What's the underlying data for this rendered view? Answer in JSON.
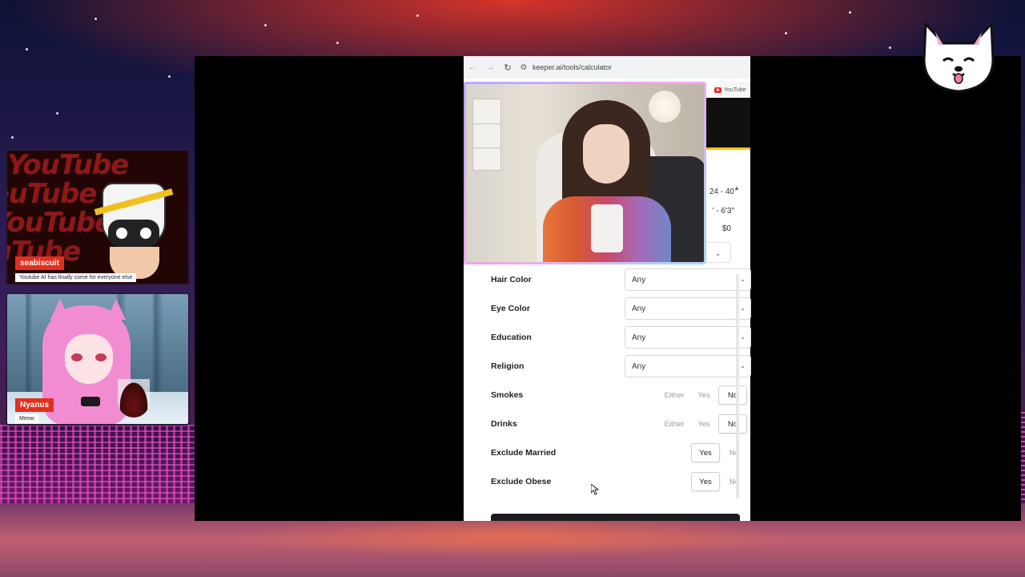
{
  "browser": {
    "url": "keeper.ai/tools/calculator",
    "youtube_tab": "YouTube",
    "partial_ranges": [
      "24 - 40",
      "' - 6'3\"",
      "$0"
    ]
  },
  "form": {
    "fields": [
      {
        "label": "Hair Color",
        "value": "Any"
      },
      {
        "label": "Eye Color",
        "value": "Any"
      },
      {
        "label": "Education",
        "value": "Any"
      },
      {
        "label": "Religion",
        "value": "Any"
      }
    ],
    "toggles": [
      {
        "label": "Smokes",
        "options": [
          "Either",
          "Yes",
          "No"
        ],
        "selected": "No"
      },
      {
        "label": "Drinks",
        "options": [
          "Either",
          "Yes",
          "No"
        ],
        "selected": "No"
      },
      {
        "label": "Exclude Married",
        "options": [
          "Yes",
          "No"
        ],
        "selected": "Yes"
      },
      {
        "label": "Exclude Obese",
        "options": [
          "Yes",
          "No"
        ],
        "selected": "Yes"
      }
    ]
  },
  "overlays": {
    "chat1": {
      "name": "seabiscuit",
      "message": "Youtube AI has finally come for everyone else"
    },
    "chat2": {
      "name": "Nyanus",
      "message": "Meow"
    },
    "pattern_text": "YouTube"
  },
  "colors": {
    "name_tag": "#e0301e",
    "webcam_border": "#f2a7e6",
    "background_top": "#d8342a"
  }
}
